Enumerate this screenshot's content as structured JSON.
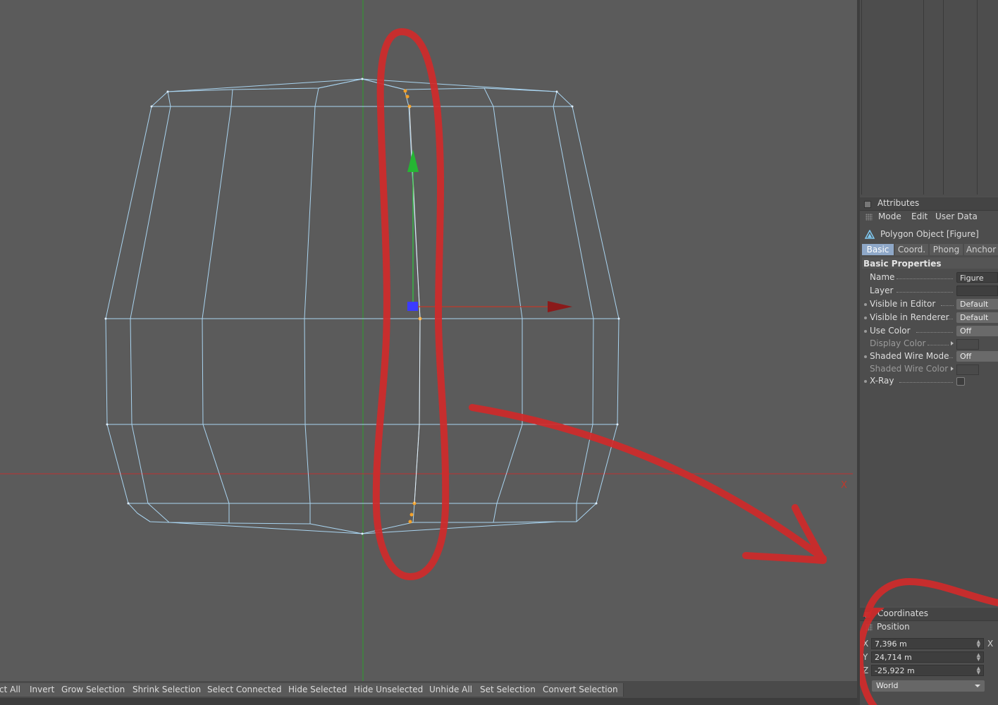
{
  "viewport": {
    "axis_x_label": "X"
  },
  "attributes": {
    "panel_title": "Attributes",
    "menu": [
      "Mode",
      "Edit",
      "User Data"
    ],
    "object_title": "Polygon Object [Figure]",
    "tabs": [
      "Basic",
      "Coord.",
      "Phong",
      "Anchor"
    ],
    "active_tab": "Basic",
    "section_title": "Basic Properties",
    "properties": {
      "name_label": "Name",
      "name_value": "Figure",
      "layer_label": "Layer",
      "layer_value": "",
      "visible_editor_label": "Visible in Editor",
      "visible_editor_value": "Default",
      "visible_renderer_label": "Visible in Renderer",
      "visible_renderer_value": "Default",
      "use_color_label": "Use Color",
      "use_color_value": "Off",
      "display_color_label": "Display Color",
      "shaded_wire_mode_label": "Shaded Wire Mode",
      "shaded_wire_mode_value": "Off",
      "shaded_wire_color_label": "Shaded Wire Color",
      "xray_label": "X-Ray"
    }
  },
  "coordinates": {
    "panel_title": "Coordinates",
    "position_label": "Position",
    "x_axis": "X",
    "x_value": "7,396 m",
    "y_axis": "Y",
    "y_value": "24,714 m",
    "z_axis": "Z",
    "z_value": "-25,922 m",
    "side_x": "X",
    "coord_system": "World"
  },
  "command_bar": {
    "buttons": [
      "ct All",
      "Invert",
      "Grow Selection",
      "Shrink Selection",
      "Select Connected",
      "Hide Selected",
      "Hide Unselected",
      "Unhide All",
      "Set Selection",
      "Convert Selection"
    ]
  },
  "colors": {
    "wire": "#a9d4f0",
    "annotation": "#d02a2a",
    "axis_x": "#c0392b",
    "axis_y": "#2e9e2e",
    "point": "#f2a12a",
    "handle": "#3b3bff"
  }
}
